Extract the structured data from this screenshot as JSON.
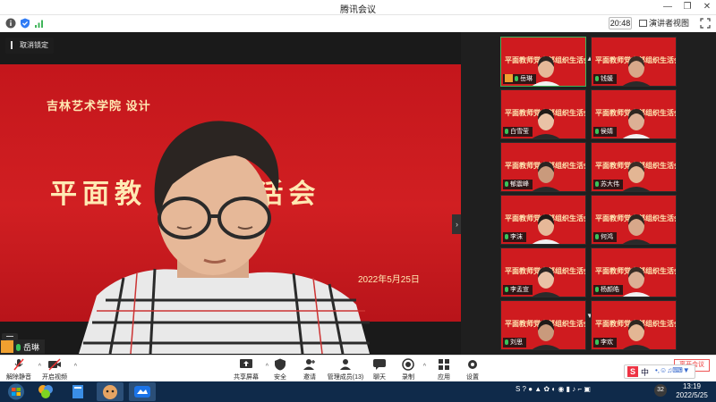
{
  "window": {
    "title": "腾讯会议"
  },
  "topbar": {
    "time": "20:48",
    "view_label": "演讲者视图"
  },
  "main": {
    "unpin_label": "取消锁定",
    "slide_subtitle": "吉林艺术学院  设计",
    "slide_title": "平面教         组织生活会",
    "slide_date": "2022年5月25日",
    "speaker_name": "岳琳"
  },
  "gallery": [
    {
      "name": "岳琳",
      "title": "平面教师党支部组织生活会",
      "active": true,
      "avatar": true
    },
    {
      "name": "钱媛",
      "title": "平面教师党支部组织生活会",
      "active": false,
      "avatar": false
    },
    {
      "name": "白雪莹",
      "title": "平面教师党支部组织生活会",
      "active": false,
      "avatar": false
    },
    {
      "name": "侯婧",
      "title": "平面教师党支部组织生活会",
      "active": false,
      "avatar": false
    },
    {
      "name": "郁震峰",
      "title": "平面教师党支部组织生活会",
      "active": false,
      "avatar": false
    },
    {
      "name": "苏大伟",
      "title": "平面教师党支部组织生活会",
      "active": false,
      "avatar": false
    },
    {
      "name": "李沫",
      "title": "平面教师党支部组织生活会",
      "active": false,
      "avatar": false
    },
    {
      "name": "何鸿",
      "title": "平面教师党支部组织生活会",
      "active": false,
      "avatar": false
    },
    {
      "name": "李孟宣",
      "title": "平面教师党支部组织生活会",
      "active": false,
      "avatar": false
    },
    {
      "name": "杨颜皓",
      "title": "平面教师党支部组织生活会",
      "active": false,
      "avatar": false
    },
    {
      "name": "刘思",
      "title": "平面教师党支部组织生活会",
      "active": false,
      "avatar": false
    },
    {
      "name": "李欢",
      "title": "平面教师党支部组织生活会",
      "active": false,
      "avatar": false
    }
  ],
  "toolbar": {
    "mute": "解除静音",
    "video": "开启视频",
    "share": "共享屏幕",
    "security": "安全",
    "invite": "邀请",
    "members": "管理成员(13)",
    "chat": "聊天",
    "record": "录制",
    "apps": "应用",
    "settings": "设置"
  },
  "taskbar": {
    "time": "13:19",
    "date": "2022/5/25",
    "ime": "中",
    "badge": "32",
    "end_label": "离开会议"
  },
  "colors": {
    "slide_red": "#cf1b1f",
    "slide_text": "#ffe9b3",
    "active_border": "#3fb55a"
  }
}
